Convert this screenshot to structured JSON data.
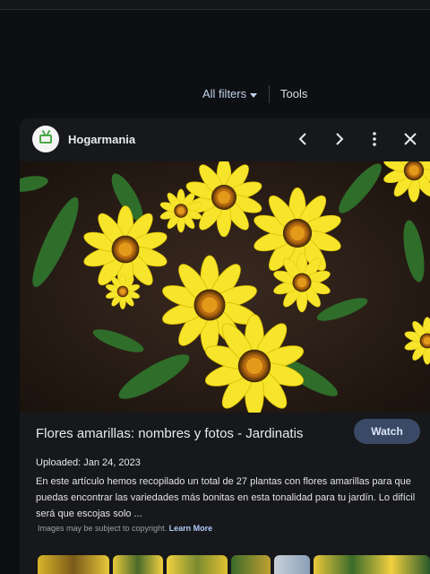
{
  "filters": {
    "all_filters": "All filters",
    "tools": "Tools"
  },
  "panel": {
    "site_name": "Hogarmania",
    "result_title": "Flores amarillas: nombres y fotos - Jardinatis",
    "watch_label": "Watch",
    "uploaded": "Uploaded: Jan 24, 2023",
    "description": "En este artículo hemos recopilado un total de 27 plantas con flores amarillas para que puedas encontrar las variedades más bonitas en esta tonalidad para tu jardín. Lo difícil será que escojas solo ...",
    "copyright_text": "Images may be subject to copyright.",
    "learn_more": "Learn More"
  },
  "icons": {
    "prev": "chevron-left-icon",
    "next": "chevron-right-icon",
    "more": "more-vertical-icon",
    "close": "close-icon"
  },
  "colors": {
    "accent_button": "#3a4a66",
    "link": "#aecbfa",
    "background": "#0d0f12"
  }
}
